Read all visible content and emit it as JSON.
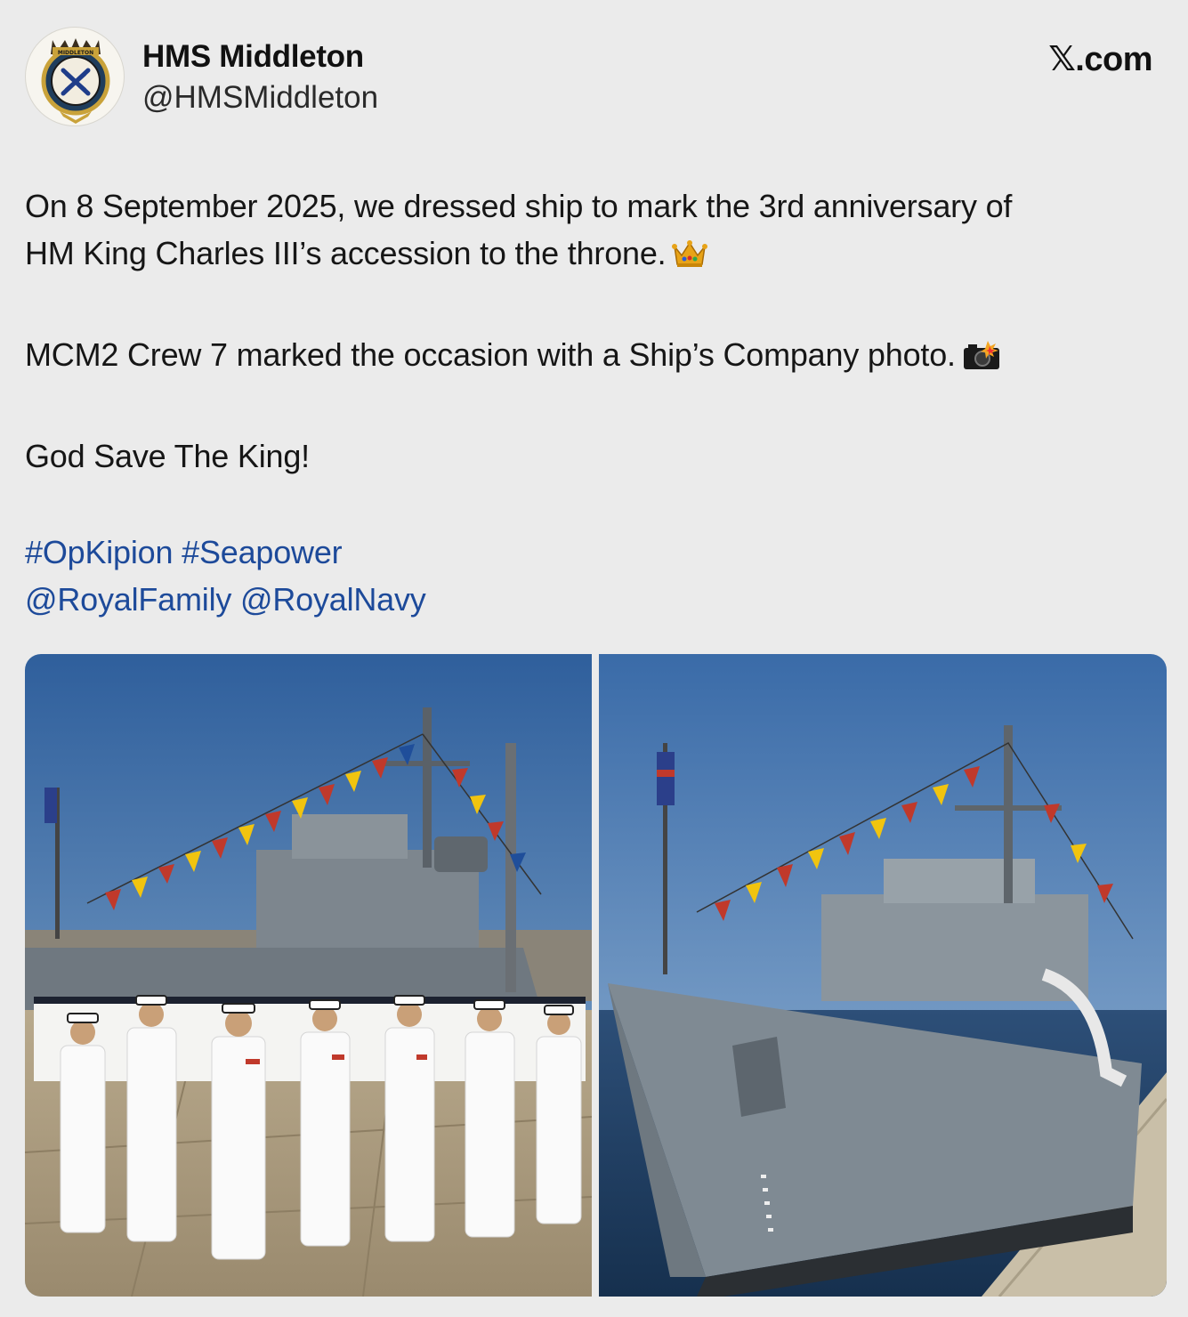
{
  "author": {
    "display_name": "HMS Middleton",
    "handle": "@HMSMiddleton",
    "avatar_crest_text": "MIDDLETON"
  },
  "brand": "𝕏.com",
  "tweet": {
    "line1": "On 8 September 2025, we dressed ship to mark the 3rd anniversary of",
    "line2": "HM King Charles III’s accession to the throne.",
    "line2_emoji": "crown-emoji",
    "line3": "MCM2 Crew 7 marked the occasion with a Ship’s Company photo.",
    "line3_emoji": "camera-flash-emoji",
    "line4": "God Save The King!",
    "hashtags": [
      "#OpKipion",
      "#Seapower"
    ],
    "mentions": [
      "@RoyalFamily",
      "@RoyalNavy"
    ]
  },
  "media": {
    "photos": [
      {
        "subject": "ship-company-photo"
      },
      {
        "subject": "ship-bow-photo"
      }
    ]
  },
  "colors": {
    "background": "#ebebeb",
    "link": "#1d4a9a",
    "text": "#161616"
  }
}
